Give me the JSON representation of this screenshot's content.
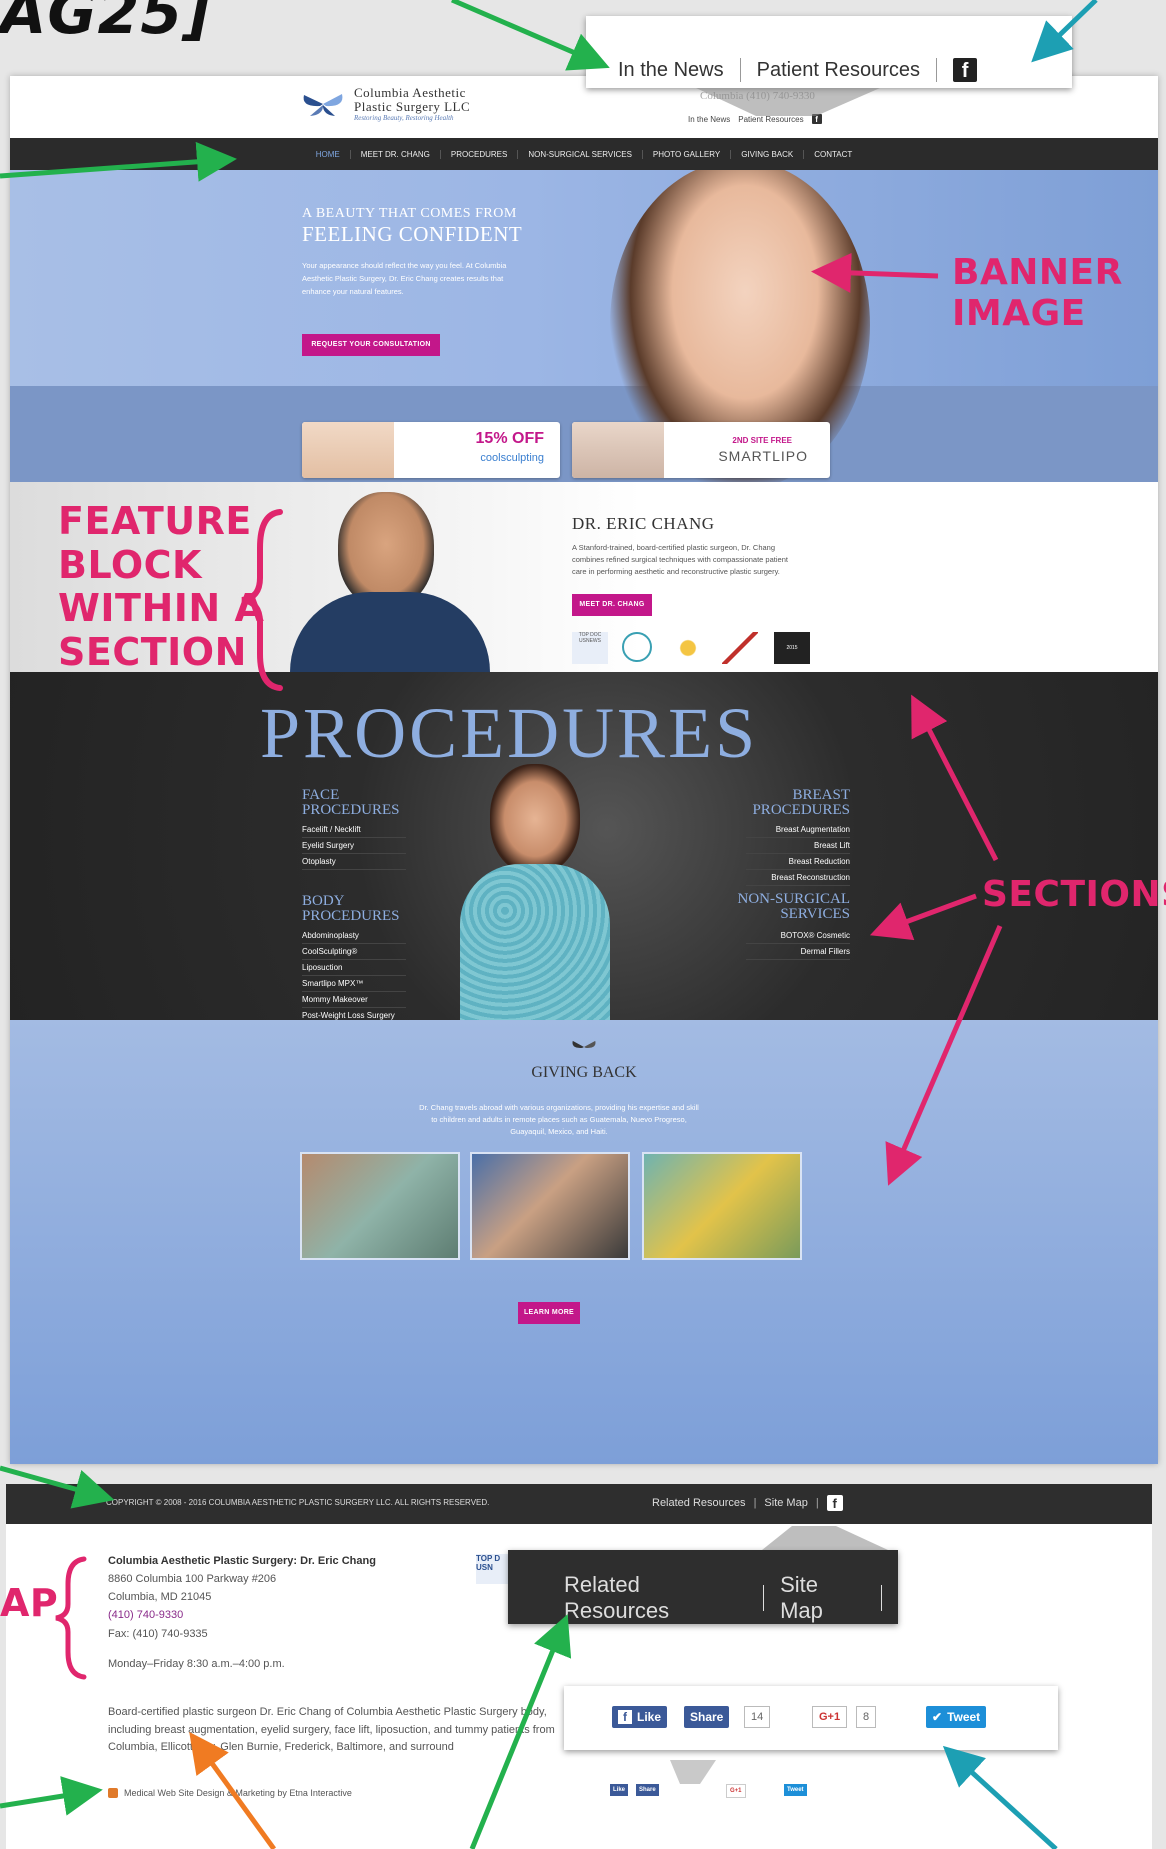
{
  "corner_title": "AG25]",
  "site": {
    "logo_name_1": "Columbia Aesthetic",
    "logo_name_2": "Plastic Surgery LLC",
    "logo_tagline": "Restoring Beauty, Restoring Health",
    "header_phone": "Columbia (410) 740-9330",
    "header_links": [
      "In the News",
      "Patient Resources",
      "f"
    ],
    "nav": [
      "HOME",
      "MEET DR. CHANG",
      "PROCEDURES",
      "NON-SURGICAL SERVICES",
      "PHOTO GALLERY",
      "GIVING BACK",
      "CONTACT"
    ],
    "banner": {
      "supertitle": "A BEAUTY THAT COMES FROM",
      "title": "FEELING CONFIDENT",
      "copy": "Your appearance should reflect the way you feel. At Columbia Aesthetic Plastic Surgery, Dr. Eric Chang creates results that enhance your natural features.",
      "cta": "REQUEST YOUR CONSULTATION",
      "promo1_big": "15% OFF",
      "promo1_sub": "coolsculpting",
      "promo2_small": "2ND SITE FREE",
      "promo2_brand": "SMARTLIPO"
    },
    "feature": {
      "name": "DR. ERIC CHANG",
      "copy": "A Stanford-trained, board-certified plastic surgeon, Dr. Chang combines refined surgical techniques with compassionate patient care in performing aesthetic and reconstructive plastic surgery.",
      "cta": "MEET DR. CHANG",
      "badges": [
        "TOP DOC USNEWS",
        "",
        "",
        "",
        "2015"
      ]
    },
    "procedures": {
      "title": "PROCEDURES",
      "face_head": [
        "FACE",
        "PROCEDURES"
      ],
      "face_items": [
        "Facelift / Necklift",
        "Eyelid Surgery",
        "Otoplasty"
      ],
      "body_head": [
        "BODY",
        "PROCEDURES"
      ],
      "body_items": [
        "Abdominoplasty",
        "CoolSculpting®",
        "Liposuction",
        "Smartlipo MPX™",
        "Mommy Makeover",
        "Post-Weight Loss Surgery"
      ],
      "breast_head": [
        "BREAST",
        "PROCEDURES"
      ],
      "breast_items": [
        "Breast Augmentation",
        "Breast Lift",
        "Breast Reduction",
        "Breast Reconstruction"
      ],
      "nonsurg_head": [
        "NON-SURGICAL",
        "SERVICES"
      ],
      "nonsurg_items": [
        "BOTOX® Cosmetic",
        "Dermal Fillers"
      ]
    },
    "giving": {
      "title": "GIVING BACK",
      "copy": "Dr. Chang travels abroad with various organizations, providing his expertise and skill to children and adults in remote places such as Guatemala, Nuevo Progreso, Guayaquil, Mexico, and Haiti.",
      "cta": "LEARN MORE"
    }
  },
  "footer": {
    "copyright": "COPYRIGHT © 2008 - 2016 COLUMBIA AESTHETIC PLASTIC SURGERY LLC. ALL RIGHTS RESERVED.",
    "links": [
      "Related Resources",
      "Site Map"
    ],
    "address": {
      "name": "Columbia Aesthetic Plastic Surgery: Dr. Eric Chang",
      "street": "8860 Columbia 100 Parkway #206",
      "city": "Columbia, MD 21045",
      "phone": "(410) 740-9330",
      "fax": "Fax: (410) 740-9335",
      "hours": "Monday–Friday 8:30 a.m.–4:00 p.m."
    },
    "blurb": "Board-certified plastic surgeon Dr. Eric Chang of Columbia Aesthetic Plastic Surgery body, including breast augmentation, eyelid surgery, face lift, liposuction, and tummy patients from Columbia, Ellicott City, Glen Burnie, Frederick, Baltimore, and surround",
    "credit": "Medical Web Site Design & Marketing by Etna Interactive",
    "badge_text": "TOP D USN"
  },
  "callouts": {
    "top": [
      "In the News",
      "Patient Resources"
    ],
    "related": [
      "Related Resources",
      "Site Map"
    ],
    "social": {
      "like": "Like",
      "share": "Share",
      "share_count": "14",
      "gplus": "G+1",
      "gplus_count": "8",
      "tweet": "Tweet"
    }
  },
  "annotations": {
    "banner_image": [
      "BANNER",
      "IMAGE"
    ],
    "feature_block": [
      "FEATURE",
      "BLOCK",
      "WITHIN A",
      "SECTION"
    ],
    "sections": "SECTIONS",
    "map_partial": "AP"
  },
  "colors": {
    "annotation_pink": "#e0266d",
    "arrow_green": "#23b14d",
    "arrow_teal": "#1d9fb3",
    "arrow_orange": "#f07b22",
    "nav_dark": "#2b2b2b",
    "brand_blue": "#8eaee0",
    "cta_magenta": "#c3178a"
  }
}
